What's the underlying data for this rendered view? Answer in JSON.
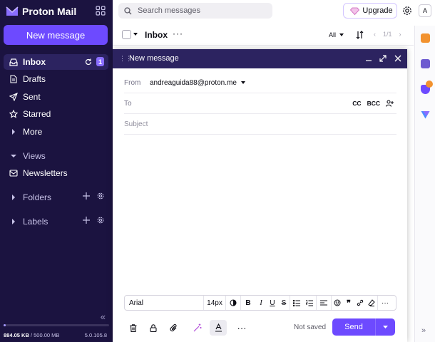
{
  "app": {
    "logo_text": "Proton Mail"
  },
  "sidebar": {
    "new_message_label": "New message",
    "inbox": {
      "label": "Inbox",
      "count": "1"
    },
    "drafts_label": "Drafts",
    "sent_label": "Sent",
    "starred_label": "Starred",
    "more_label": "More",
    "views_label": "Views",
    "newsletters_label": "Newsletters",
    "folders_label": "Folders",
    "labels_label": "Labels",
    "storage": {
      "used": "884.05 KB",
      "separator": " / ",
      "total": "500.00 MB",
      "used_fraction": 0.002
    },
    "version": "5.0.105.8"
  },
  "topbar": {
    "search_placeholder": "Search messages",
    "upgrade_label": "Upgrade",
    "avatar_initial": "A"
  },
  "mail_toolbar": {
    "title": "Inbox",
    "filter_label": "All",
    "page_indicator": "1/1"
  },
  "composer": {
    "title": "New message",
    "from_label": "From",
    "from_value": "andreaguida88@proton.me",
    "to_label": "To",
    "cc_label": "CC",
    "bcc_label": "BCC",
    "subject_placeholder": "Subject",
    "font_family": "Arial",
    "font_size": "14px",
    "status": "Not saved",
    "send_label": "Send"
  },
  "colors": {
    "sidebar_bg": "#1b1340",
    "accent": "#6d4aff",
    "composer_header": "#2c2360"
  }
}
